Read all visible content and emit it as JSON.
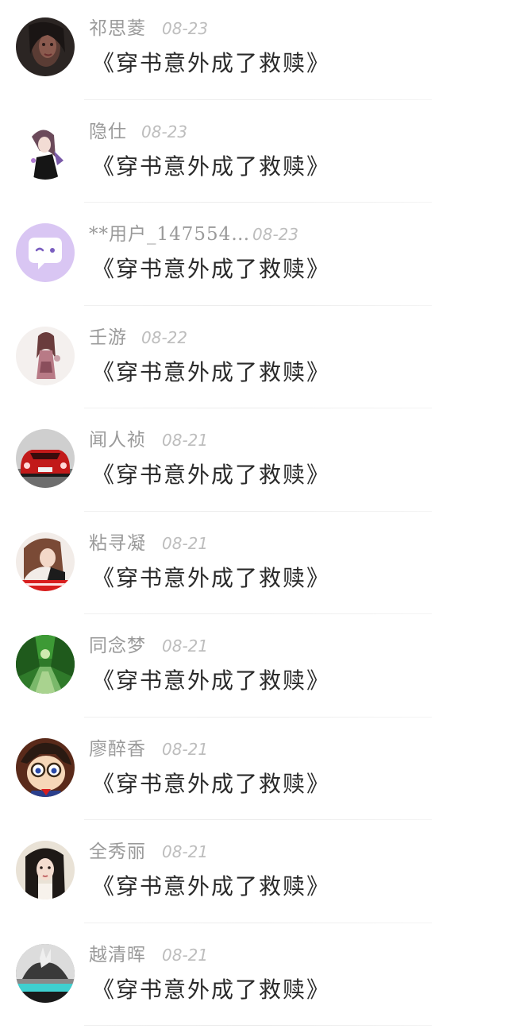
{
  "comments": [
    {
      "name": "祁思菱",
      "date": "08-23",
      "title": "《穿书意外成了救赎》",
      "avatar": "dark-portrait-avatar"
    },
    {
      "name": "隐仕",
      "date": "08-23",
      "title": "《穿书意外成了救赎》",
      "avatar": "anime-girl-avatar"
    },
    {
      "name": "**用户_147554…",
      "date": "08-23",
      "title": "《穿书意外成了救赎》",
      "avatar": "chat-bubble-avatar"
    },
    {
      "name": "壬游",
      "date": "08-22",
      "title": "《穿书意外成了救赎》",
      "avatar": "anime-figure-avatar"
    },
    {
      "name": "闻人祯",
      "date": "08-21",
      "title": "《穿书意外成了救赎》",
      "avatar": "red-car-avatar"
    },
    {
      "name": "粘寻凝",
      "date": "08-21",
      "title": "《穿书意外成了救赎》",
      "avatar": "cartoon-girl-avatar"
    },
    {
      "name": "同念梦",
      "date": "08-21",
      "title": "《穿书意外成了救赎》",
      "avatar": "green-garden-avatar"
    },
    {
      "name": "廖醉香",
      "date": "08-21",
      "title": "《穿书意外成了救赎》",
      "avatar": "anime-boy-glasses-avatar"
    },
    {
      "name": "全秀丽",
      "date": "08-21",
      "title": "《穿书意外成了救赎》",
      "avatar": "girl-photo-avatar"
    },
    {
      "name": "越清晖",
      "date": "08-21",
      "title": "《穿书意外成了救赎》",
      "avatar": "bw-hand-avatar"
    }
  ]
}
